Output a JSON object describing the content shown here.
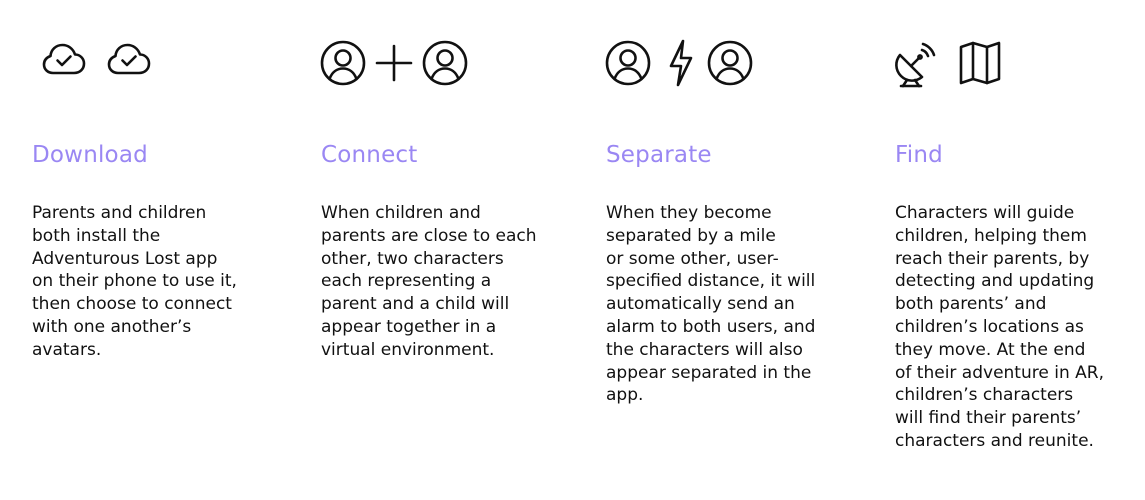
{
  "accent_color": "#9a87f3",
  "steps": [
    {
      "title": "Download",
      "description": "Parents and children\nboth install the\nAdventurous Lost app\non their phone to use it,\nthen choose to connect\nwith one another’s\navatars.",
      "icons": [
        "cloud-check-icon",
        "cloud-check-icon"
      ]
    },
    {
      "title": "Connect",
      "description": "When children and\nparents are close to each\nother, two characters\neach representing a\nparent and a child will\nappear together in a\nvirtual environment.",
      "icons": [
        "user-circle-icon",
        "plus-icon",
        "user-circle-icon"
      ]
    },
    {
      "title": "Separate",
      "description": "When they become\nseparated by a mile\nor some other, user-\nspecified distance, it will\nautomatically send an\nalarm to both users, and\nthe characters will also\nappear separated in the\napp.",
      "icons": [
        "user-circle-icon",
        "lightning-icon",
        "user-circle-icon"
      ]
    },
    {
      "title": "Find",
      "description": "Characters will guide\nchildren, helping them\nreach their parents, by\ndetecting and updating\nboth parents’ and\nchildren’s locations as\nthey move. At the end\nof their adventure in AR,\nchildren’s characters\nwill find their parents’\ncharacters and reunite.",
      "icons": [
        "satellite-dish-icon",
        "map-icon"
      ]
    }
  ]
}
